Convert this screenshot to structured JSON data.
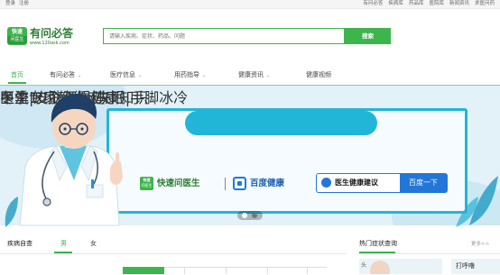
{
  "topbar": {
    "login": "登录",
    "register": "注册",
    "links": [
      "有问必答",
      "疾病库",
      "药品库",
      "医院库",
      "新闻资讯",
      "求医问药"
    ]
  },
  "header": {
    "logo_badge_top": "快速",
    "logo_badge_bottom": "问医生",
    "logo_name": "有问必答",
    "logo_url": "www.120ask.com",
    "search_placeholder": "请输入疾病、症状、药品、问题",
    "search_button": "搜索"
  },
  "nav": {
    "items": [
      {
        "label": "首页",
        "active": true,
        "has_chevron": false
      },
      {
        "label": "有问必答",
        "active": false,
        "has_chevron": true
      },
      {
        "label": "医疗信息",
        "active": false,
        "has_chevron": true
      },
      {
        "label": "用药指导",
        "active": false,
        "has_chevron": true
      },
      {
        "label": "健康资讯",
        "active": false,
        "has_chevron": true
      },
      {
        "label": "健康视频",
        "active": false,
        "has_chevron": false
      }
    ]
  },
  "banner": {
    "title": "冬季10个必看健康知识",
    "line2_left": "医生专家教你应对",
    "line2_right": "甲流|皮肤干燥|失眠|手脚冰冷",
    "brand1_badge_top": "快速",
    "brand1_badge_bottom": "问医生",
    "brand1_name": "快速问医生",
    "brand2_name": "百度健康",
    "advice_label": "医生健康建议",
    "advice_button": "百度一下",
    "accent_color": "#21b6d7",
    "slides_total": 2,
    "slide_active": 1
  },
  "bottom": {
    "disease_section_title": "疾病自查",
    "tab_male": "男",
    "tab_female": "女",
    "hot_section_title": "热门症状查询",
    "hot_more": "更多>>",
    "hot_card1_label": "头",
    "hot_card2_label": "打呼噜"
  },
  "colors": {
    "brand_green": "#3cb54a",
    "baidu_blue": "#2277d6"
  }
}
